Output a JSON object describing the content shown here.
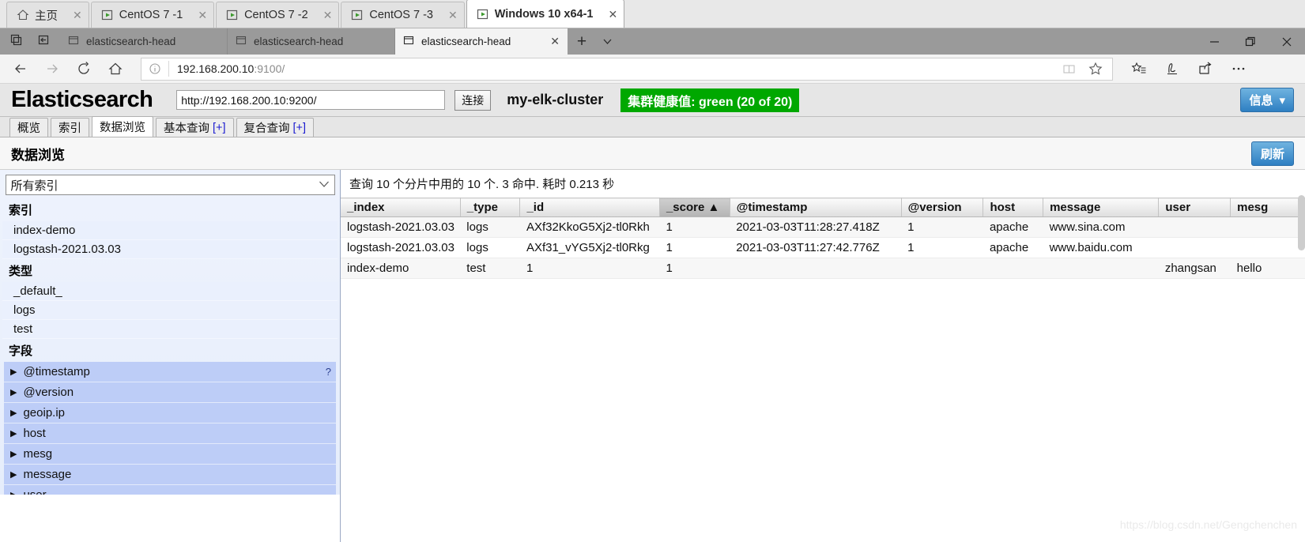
{
  "vm_tabs": [
    {
      "label": "主页",
      "icon": "home-icon",
      "active": false,
      "closable": true
    },
    {
      "label": "CentOS 7 -1",
      "icon": "vm-icon",
      "active": false,
      "closable": true
    },
    {
      "label": "CentOS 7 -2",
      "icon": "vm-icon",
      "active": false,
      "closable": true
    },
    {
      "label": "CentOS 7 -3",
      "icon": "vm-icon",
      "active": false,
      "closable": true
    },
    {
      "label": "Windows 10 x64-1",
      "icon": "vm-icon",
      "active": true,
      "closable": true
    }
  ],
  "browser": {
    "tabs": [
      {
        "label": "elasticsearch-head",
        "active": false
      },
      {
        "label": "elasticsearch-head",
        "active": false
      },
      {
        "label": "elasticsearch-head",
        "active": true
      }
    ],
    "new_tab_label": "+",
    "tab_menu_label": "⌄",
    "window_controls": {
      "minimize": "—",
      "maximize": "❐",
      "close": "✕"
    },
    "address": {
      "host": "192.168.200.10",
      "path": ":9100/",
      "full": "192.168.200.10:9100/"
    },
    "nav": {
      "back": "←",
      "forward": "→",
      "refresh": "⟳",
      "home": "⌂"
    },
    "toolbar_icons": [
      "reading-view-icon",
      "favorite-star-icon",
      "favorites-hub-icon",
      "web-note-icon",
      "share-icon",
      "more-icon"
    ]
  },
  "es": {
    "logo": "Elasticsearch",
    "url_value": "http://192.168.200.10:9200/",
    "connect_label": "连接",
    "cluster_name": "my-elk-cluster",
    "health_text": "集群健康值: green (20 of 20)",
    "health_color": "#00a800",
    "info_button": "信息",
    "info_caret": "▾",
    "tabs": [
      {
        "label": "概览",
        "plus": "",
        "active": false
      },
      {
        "label": "索引",
        "plus": "",
        "active": false
      },
      {
        "label": "数据浏览",
        "plus": "",
        "active": true
      },
      {
        "label": "基本查询",
        "plus": "[+]",
        "active": false
      },
      {
        "label": "复合查询",
        "plus": "[+]",
        "active": false
      }
    ],
    "subtitle": "数据浏览",
    "refresh_label": "刷新",
    "sidebar": {
      "index_select_value": "所有索引",
      "index_select_caret": "⌄",
      "groups": [
        {
          "title": "索引",
          "items": [
            "index-demo",
            "logstash-2021.03.03"
          ]
        },
        {
          "title": "类型",
          "items": [
            "_default_",
            "logs",
            "test"
          ]
        }
      ],
      "fields_title": "字段",
      "fields": [
        {
          "label": "@timestamp",
          "help": "?"
        },
        {
          "label": "@version",
          "help": ""
        },
        {
          "label": "geoip.ip",
          "help": ""
        },
        {
          "label": "host",
          "help": ""
        },
        {
          "label": "mesg",
          "help": ""
        },
        {
          "label": "message",
          "help": ""
        },
        {
          "label": "user",
          "help": ""
        }
      ]
    },
    "results": {
      "summary": "查询 10 个分片中用的 10 个. 3 命中. 耗时 0.213 秒",
      "columns": [
        "_index",
        "_type",
        "_id",
        "_score",
        "@timestamp",
        "@version",
        "host",
        "message",
        "user",
        "mesg"
      ],
      "sorted_column": "_score",
      "sort_arrow": "▲",
      "rows": [
        {
          "_index": "logstash-2021.03.03",
          "_type": "logs",
          "_id": "AXf32KkoG5Xj2-tl0Rkh",
          "_score": "1",
          "@timestamp": "2021-03-03T11:28:27.418Z",
          "@version": "1",
          "host": "apache",
          "message": "www.sina.com",
          "user": "",
          "mesg": ""
        },
        {
          "_index": "logstash-2021.03.03",
          "_type": "logs",
          "_id": "AXf31_vYG5Xj2-tl0Rkg",
          "_score": "1",
          "@timestamp": "2021-03-03T11:27:42.776Z",
          "@version": "1",
          "host": "apache",
          "message": "www.baidu.com",
          "user": "",
          "mesg": ""
        },
        {
          "_index": "index-demo",
          "_type": "test",
          "_id": "1",
          "_score": "1",
          "@timestamp": "",
          "@version": "",
          "host": "",
          "message": "",
          "user": "zhangsan",
          "mesg": "hello "
        }
      ]
    }
  },
  "watermark": "https://blog.csdn.net/Gengchenchen"
}
